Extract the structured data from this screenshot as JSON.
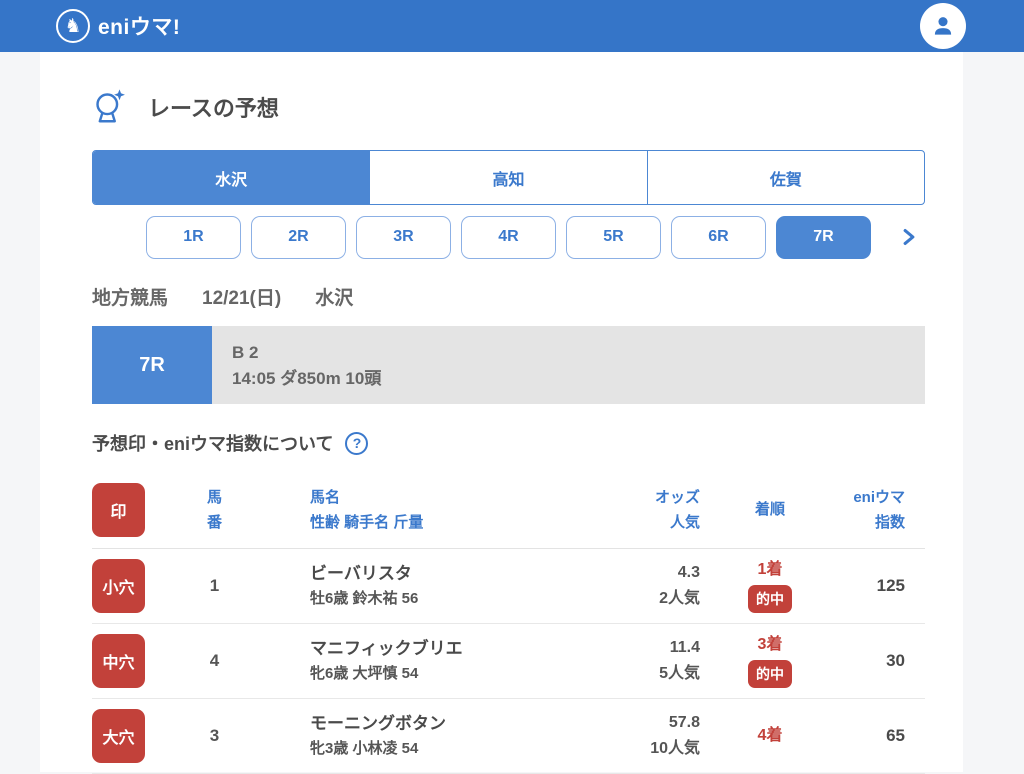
{
  "header": {
    "brand": "eniウマ!"
  },
  "section": {
    "title": "レースの予想"
  },
  "venue_tabs": {
    "items": [
      {
        "label": "水沢",
        "selected": true
      },
      {
        "label": "高知",
        "selected": false
      },
      {
        "label": "佐賀",
        "selected": false
      }
    ]
  },
  "race_rounds": {
    "items": [
      "1R",
      "2R",
      "3R",
      "4R",
      "5R",
      "6R",
      "7R"
    ],
    "selected": "7R"
  },
  "race_meta": {
    "category": "地方競馬",
    "date": "12/21(日)",
    "venue": "水沢"
  },
  "race_banner": {
    "round": "7R",
    "grade": "B 2",
    "conditions": "14:05 ダ850m 10頭"
  },
  "about": {
    "label": "予想印・eniウマ指数について",
    "help": "?"
  },
  "table": {
    "headers": {
      "mark": "印",
      "number_line1": "馬",
      "number_line2": "番",
      "name_line1": "馬名",
      "name_line2": "性齢  騎手名  斤量",
      "odds_line1": "オッズ",
      "odds_line2": "人気",
      "finish": "着順",
      "index_line1": "eniウマ",
      "index_line2": "指数"
    },
    "rows": [
      {
        "mark": "小穴",
        "number": "1",
        "name": "ビーバリスタ",
        "detail": "牡6歳 鈴木祐 56",
        "odds": "4.3",
        "popularity": "2人気",
        "finish": "1着",
        "hit": "的中",
        "index": "125"
      },
      {
        "mark": "中穴",
        "number": "4",
        "name": "マニフィックブリエ",
        "detail": "牝6歳 大坪慎 54",
        "odds": "11.4",
        "popularity": "5人気",
        "finish": "3着",
        "hit": "的中",
        "index": "30"
      },
      {
        "mark": "大穴",
        "number": "3",
        "name": "モーニングボタン",
        "detail": "牝3歳 小林凌 54",
        "odds": "57.8",
        "popularity": "10人気",
        "finish": "4着",
        "index": "65"
      }
    ]
  },
  "colors": {
    "header_blue": "#3575c8",
    "accent_blue": "#4c87d3",
    "text_blue": "#3b79cc",
    "badge_red": "#c2413a",
    "banner_gray": "#e4e4e4"
  }
}
